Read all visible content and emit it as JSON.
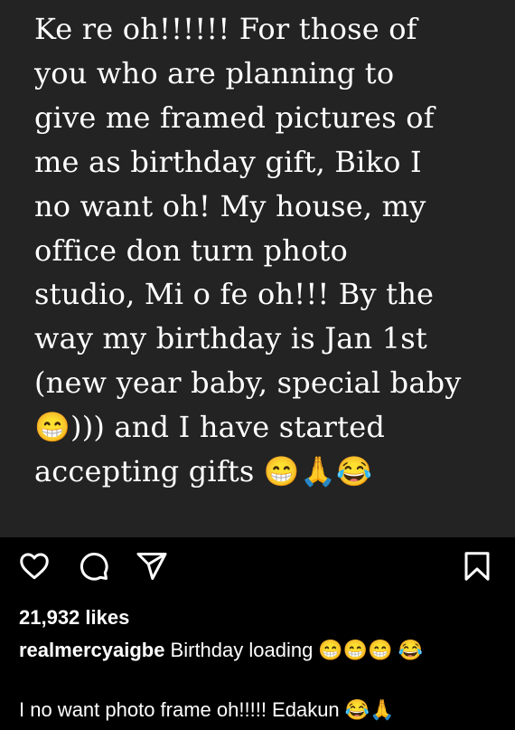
{
  "post": {
    "text": "Ke re oh!!!!!! For those of\nyou who are planning to\ngive me framed pictures of\nme as birthday gift, Biko I\nno want oh! My house, my\noffice don turn photo\nstudio, Mi o fe oh!!! By the\nway my birthday is Jan 1st\n(new year baby, special baby\n😁))) and I have started\naccepting gifts 😁🙏😂"
  },
  "actions": {
    "icons": [
      "heart-icon",
      "comment-icon",
      "share-icon",
      "bookmark-icon"
    ]
  },
  "likes": "21,932 likes",
  "caption": {
    "username": "realmercyaigbe",
    "text": " Birthday loading 😁😁😁 😂"
  },
  "comment": {
    "text": "I no want photo frame oh!!!!! Edakun 😂🙏"
  }
}
